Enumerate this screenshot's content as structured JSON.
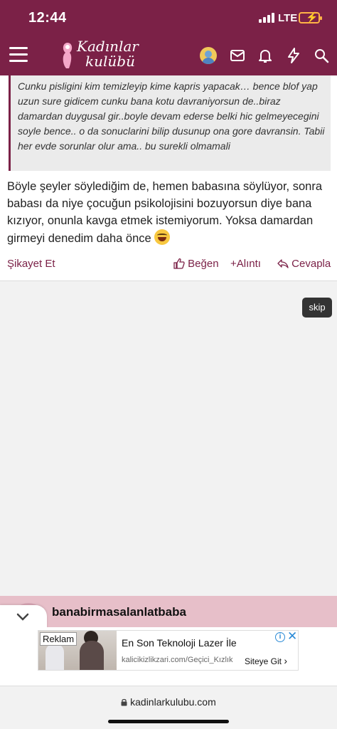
{
  "status_bar": {
    "time": "12:44",
    "network": "LTE"
  },
  "header": {
    "logo_line1": "Kadınlar",
    "logo_line2": "kulübü",
    "icons": [
      "menu-icon",
      "avatar",
      "mail-icon",
      "bell-icon",
      "bolt-icon",
      "search-icon"
    ],
    "colors": {
      "brand": "#7b2147"
    }
  },
  "post": {
    "quote": "Cunku pisligini kim temizleyip kime kapris yapacak… bence blof yap uzun sure gidicem cunku bana kotu davraniyorsun de..biraz damardan duygusal gir..boyle devam ederse belki hic gelmeyecegini soyle bence.. o da sonuclarini bilip dusunup ona gore davransin. Tabii her evde sorunlar olur ama.. bu surekli olmamali",
    "body": "Böyle şeyler söylediğim de, hemen babasına söylüyor, sonra babası da niye çocuğun psikolojisini bozuyorsun diye bana kızıyor, onunla kavga etmek istemiyorum. Yoksa damardan girmeyi denedim daha önce",
    "actions": {
      "report": "Şikayet Et",
      "like": "Beğen",
      "quote": "Alıntı",
      "reply": "Cevapla"
    }
  },
  "ad_overlay": {
    "skip_label": "skip"
  },
  "next_post": {
    "username": "banabirmasalanlatbaba"
  },
  "bottom_ad": {
    "badge": "Reklam",
    "title": "En Son Teknoloji Lazer İle",
    "url": "kalicikizlikzari.com/Geçici_Kızlık",
    "cta": "Siteye Git"
  },
  "browser": {
    "url": "kadinlarkulubu.com"
  }
}
